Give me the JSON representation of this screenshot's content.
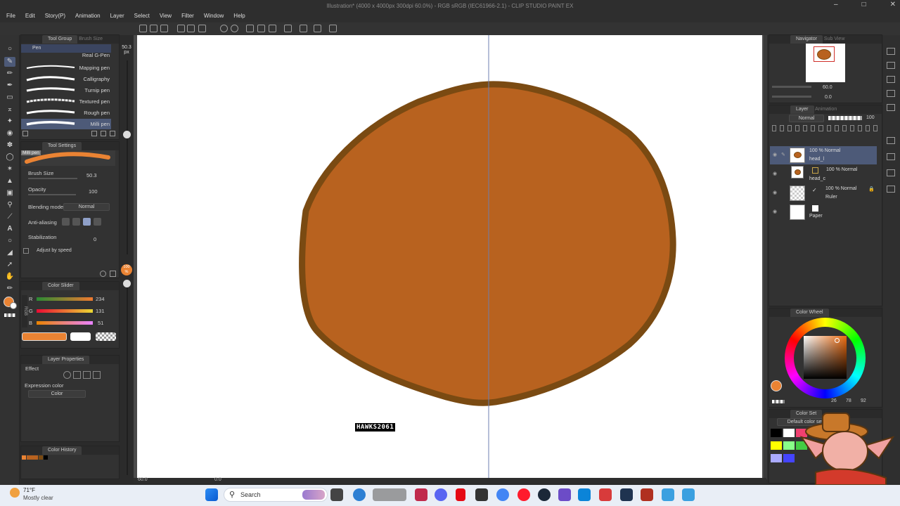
{
  "window": {
    "title": "Illustration* (4000 x 4000px 300dpi 60.0%) - RGB sRGB (IEC61966-2.1) - CLIP STUDIO PAINT EX"
  },
  "menu": [
    "File",
    "Edit",
    "Story(P)",
    "Animation",
    "Layer",
    "Select",
    "View",
    "Filter",
    "Window",
    "Help"
  ],
  "tool_group": {
    "tab1": "Tool Group",
    "tab2": "Brush Size",
    "active_tab": "Pen",
    "size_readout": "50.3",
    "size_unit": "px"
  },
  "brushes": [
    {
      "name": "Real G-Pen",
      "selected": false
    },
    {
      "name": "Mapping pen",
      "selected": false
    },
    {
      "name": "Calligraphy",
      "selected": false
    },
    {
      "name": "Turnip pen",
      "selected": false
    },
    {
      "name": "Textured pen",
      "selected": false
    },
    {
      "name": "Rough pen",
      "selected": false
    },
    {
      "name": "Milli pen",
      "selected": true
    }
  ],
  "tool_settings": {
    "title": "Tool Settings",
    "preview_label": "Milli pen",
    "brush_size_label": "Brush Size",
    "brush_size_value": "50.3",
    "opacity_label": "Opacity",
    "opacity_value": "100",
    "blending_label": "Blending mode",
    "blending_value": "Normal",
    "antialias_label": "Anti-aliasing",
    "stabilization_label": "Stabilization",
    "stabilization_value": "0",
    "adjust_label": "Adjust by speed"
  },
  "color_slider": {
    "title": "Color Slider",
    "mode": "RGB",
    "r_label": "R",
    "r_value": "234",
    "g_label": "G",
    "g_value": "131",
    "b_label": "B",
    "b_value": "51",
    "main_color": "#ea8333"
  },
  "layer_properties": {
    "title": "Layer Properties",
    "effect_label": "Effect",
    "expression_label": "Expression color",
    "expression_value": "Color"
  },
  "color_history": {
    "title": "Color History"
  },
  "side_slider": {
    "value": "100",
    "unit": "%"
  },
  "watermark": "HAWKS2061",
  "canvas": {
    "fill_color": "#b8621f",
    "stroke_color": "#7a4a12",
    "ruler_color": "#6d7fb0"
  },
  "statusbar": {
    "zoom": "60.0",
    "angle": "0.0"
  },
  "navigator": {
    "title": "Navigator",
    "tab2": "Sub View",
    "zoom": "60.0",
    "angle": "0.0"
  },
  "layer_panel": {
    "title": "Layer",
    "tab2": "Animation",
    "blend": "Normal",
    "opacity": "100"
  },
  "layers": [
    {
      "line1": "100 % Normal",
      "line2": "head_l",
      "selected": true
    },
    {
      "line1": "100 % Normal",
      "line2": "head_c",
      "selected": false
    },
    {
      "line1": "100 % Normal",
      "line2": "Ruler",
      "selected": false
    },
    {
      "line1": "",
      "line2": "Paper",
      "selected": false
    }
  ],
  "color_wheel": {
    "title": "Color Wheel",
    "h": "26",
    "s": "78",
    "v": "92"
  },
  "color_set": {
    "title": "Color Set",
    "preset": "Default color set"
  },
  "taskbar": {
    "temp": "71°F",
    "weather": "Mostly clear",
    "search": "Search"
  }
}
